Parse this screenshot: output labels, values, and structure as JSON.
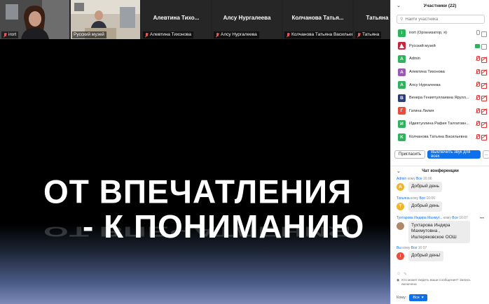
{
  "strip": {
    "tiles": [
      {
        "big": "",
        "tag": "irort",
        "muted": true
      },
      {
        "big": "",
        "tag": "Русский музей",
        "muted": false
      },
      {
        "big": "Алевтина  Тихо...",
        "tag": "Алевтина Тихонова",
        "muted": true
      },
      {
        "big": "Алсу Нургалеева",
        "tag": "Алсу Нургалеева",
        "muted": true
      },
      {
        "big": "Колчанова  Татья...",
        "tag": "Колчанова Татьяна Васильев...",
        "muted": true
      },
      {
        "big": "Татьяна",
        "tag": "Татьяна",
        "muted": true
      }
    ]
  },
  "slide": {
    "line1": "ОТ ВПЕЧАТЛЕНИЯ",
    "line2": "-  К ПОНИМАНИЮ"
  },
  "participants": {
    "title": "Участники (22)",
    "search_placeholder": "Найти участника",
    "list": [
      {
        "initial": "I",
        "color": "#2fb25e",
        "name": "irort (Организатор, я)",
        "icons": "mic-grey,cam-on"
      },
      {
        "initial": "",
        "color": "#c7253e",
        "name": "Русский музей",
        "icons": "green,cam-on"
      },
      {
        "initial": "A",
        "color": "#2fb25e",
        "name": "Admin",
        "icons": "mic,cam"
      },
      {
        "initial": "A",
        "color": "#9b59b6",
        "name": "Алевтина Тихонова",
        "icons": "mic,cam"
      },
      {
        "initial": "A",
        "color": "#2fb25e",
        "name": "Алсу Нургалеева",
        "icons": "mic,cam"
      },
      {
        "initial": "B",
        "color": "#2c3e7a",
        "name": "Венера Гениятуллаевна Ярулл...",
        "icons": "mic,cam"
      },
      {
        "initial": "Г",
        "color": "#e74c3c",
        "name": "Гатина Лилия",
        "icons": "mic,cam"
      },
      {
        "initial": "И",
        "color": "#2fb25e",
        "name": "Идиятуллина Рафия Талгатовн...",
        "icons": "mic,cam"
      },
      {
        "initial": "K",
        "color": "#2fb25e",
        "name": "Колчанова Татьяна Васильевна",
        "icons": "mic,cam"
      }
    ],
    "invite_label": "Пригласить",
    "mute_all_label": "Выключить звук для всех",
    "more_label": "..."
  },
  "chat": {
    "title": "Чат конференции",
    "messages": [
      {
        "from": "Admin",
        "to_label": "кому",
        "to": "Все",
        "time": "16:06",
        "initial": "A",
        "color": "#f0b429",
        "text": "Добрый день"
      },
      {
        "from": "Татьяна",
        "to_label": "кому",
        "to": "Все",
        "time": "16:06",
        "initial": "T",
        "color": "#f0b429",
        "text": "Добрый день"
      },
      {
        "from": "Тухтарова Индира Махмут...",
        "to_label": "кому",
        "to": "Все",
        "time": "16:07",
        "initial": "",
        "color": "#b0896b",
        "text": "Тухтарова Индира Махмутовна , Иштеряковское ООШ"
      },
      {
        "from": "Вы",
        "to_label": "кому",
        "to": "Все",
        "time": "16:07",
        "initial": "I",
        "color": "#e74c3c",
        "text": "Добрый день!"
      }
    ],
    "notice": "Кто может видеть ваши сообщения? Запись включена",
    "to_label": "Кому:",
    "to_value": "Все"
  }
}
